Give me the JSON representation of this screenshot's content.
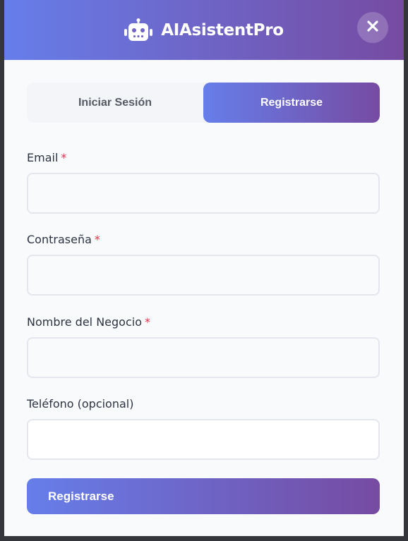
{
  "header": {
    "title": "AIAsistentPro",
    "brand_icon": "robot-icon",
    "close_icon": "close-icon"
  },
  "tabs": [
    {
      "label": "Iniciar Sesión",
      "active": false
    },
    {
      "label": "Registrarse",
      "active": true
    }
  ],
  "form": {
    "fields": [
      {
        "label": "Email",
        "required_mark": "*",
        "value": ""
      },
      {
        "label": "Contraseña",
        "required_mark": "*",
        "value": ""
      },
      {
        "label": "Nombre del Negocio",
        "required_mark": "*",
        "value": ""
      },
      {
        "label": "Teléfono (opcional)",
        "required_mark": "",
        "value": ""
      }
    ],
    "submit_label": "Registrarse"
  },
  "colors": {
    "gradient_start": "#667eea",
    "gradient_end": "#764ba2",
    "required": "#e0344a"
  }
}
